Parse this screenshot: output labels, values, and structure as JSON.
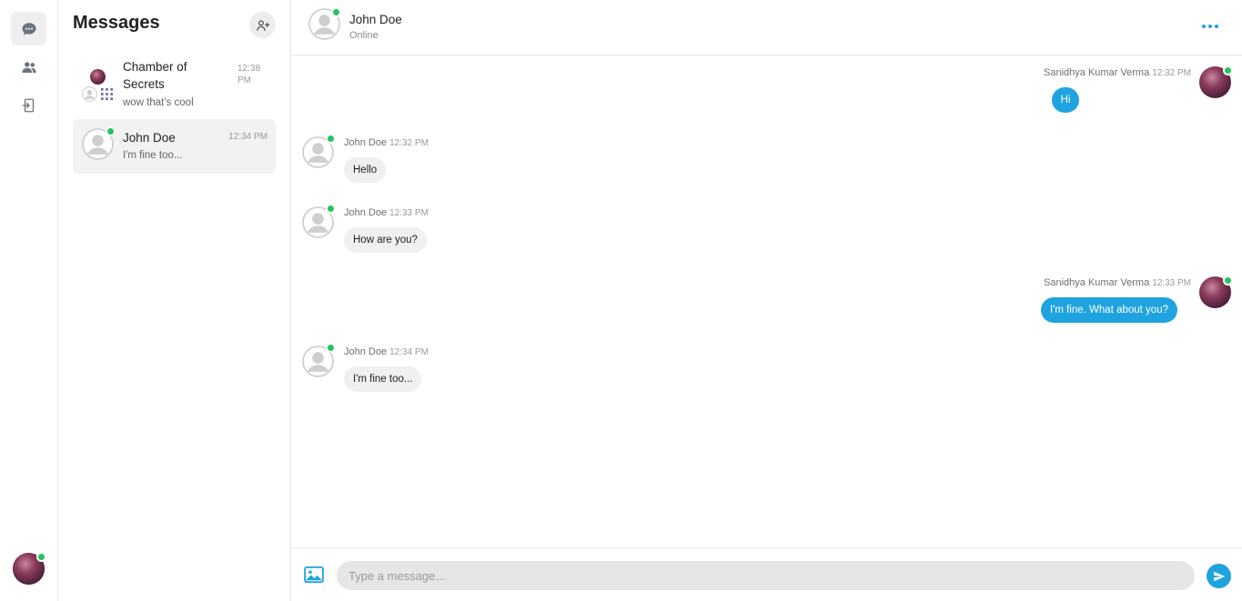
{
  "sidebar": {
    "items": [
      {
        "icon": "chat-icon",
        "active": true
      },
      {
        "icon": "users-icon",
        "active": false
      },
      {
        "icon": "logout-icon",
        "active": false
      }
    ],
    "accent": "#1fa3e0"
  },
  "conversations": {
    "title": "Messages",
    "items": [
      {
        "name": "Chamber of Secrets",
        "time": "12:38 PM",
        "preview": "wow that's cool",
        "type": "group"
      },
      {
        "name": "John Doe",
        "time": "12:34 PM",
        "preview": "I'm fine too...",
        "type": "direct",
        "online": true
      }
    ]
  },
  "chat": {
    "header": {
      "name": "John Doe",
      "status": "Online"
    },
    "messages": [
      {
        "sender": "Sanidhya Kumar Verma",
        "time": "12:32 PM",
        "text": "Hi",
        "outgoing": true
      },
      {
        "sender": "John Doe",
        "time": "12:32 PM",
        "text": "Hello",
        "outgoing": false
      },
      {
        "sender": "John Doe",
        "time": "12:33 PM",
        "text": "How are you?",
        "outgoing": false
      },
      {
        "sender": "Sanidhya Kumar Verma",
        "time": "12:33 PM",
        "text": "I'm fine. What about you?",
        "outgoing": true
      },
      {
        "sender": "John Doe",
        "time": "12:34 PM",
        "text": "I'm fine too...",
        "outgoing": false
      }
    ],
    "composer": {
      "placeholder": "Type a message..."
    }
  },
  "colors": {
    "accent": "#1fa3e0",
    "online": "#22c55e",
    "bubble_in": "#f0f0f0"
  }
}
